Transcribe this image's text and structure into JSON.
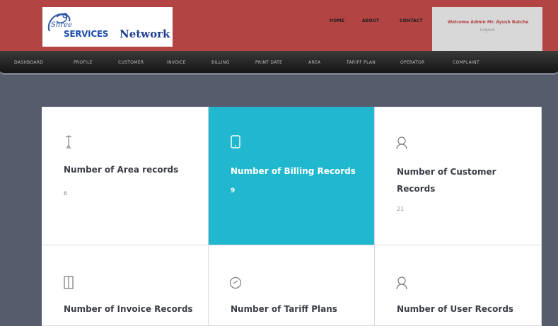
{
  "brand": {
    "logo_shree": "Shree",
    "logo_services": "SERVICES",
    "logo_network": "Network"
  },
  "top_links": {
    "home": "HOME",
    "about": "ABOUT",
    "contact": "CONTACT"
  },
  "user": {
    "welcome": "Welcome Admin Mr. Ayush Batche",
    "logout": "Logout"
  },
  "nav": {
    "items": [
      "DASHBOARD",
      "PROFILE",
      "CUSTOMER",
      "INVOICE",
      "BILLING",
      "PRINT DATE",
      "AREA",
      "TARIFF PLAN",
      "OPERATOR",
      "COMPLAINT"
    ]
  },
  "cards": [
    {
      "title": "Number of Area records",
      "value": "6",
      "icon": "area-icon"
    },
    {
      "title": "Number of Billing Records",
      "value": "9",
      "icon": "billing-icon"
    },
    {
      "title": "Number of Customer Records",
      "value": "21",
      "icon": "customer-icon"
    },
    {
      "title": "Number of Invoice Records",
      "value": "",
      "icon": "invoice-icon"
    },
    {
      "title": "Number of Tariff Plans",
      "value": "",
      "icon": "tariff-icon"
    },
    {
      "title": "Number of User Records",
      "value": "",
      "icon": "user-icon"
    }
  ],
  "colors": {
    "header": "#b24443",
    "accent": "#21b8cf",
    "background": "#575c6d"
  }
}
